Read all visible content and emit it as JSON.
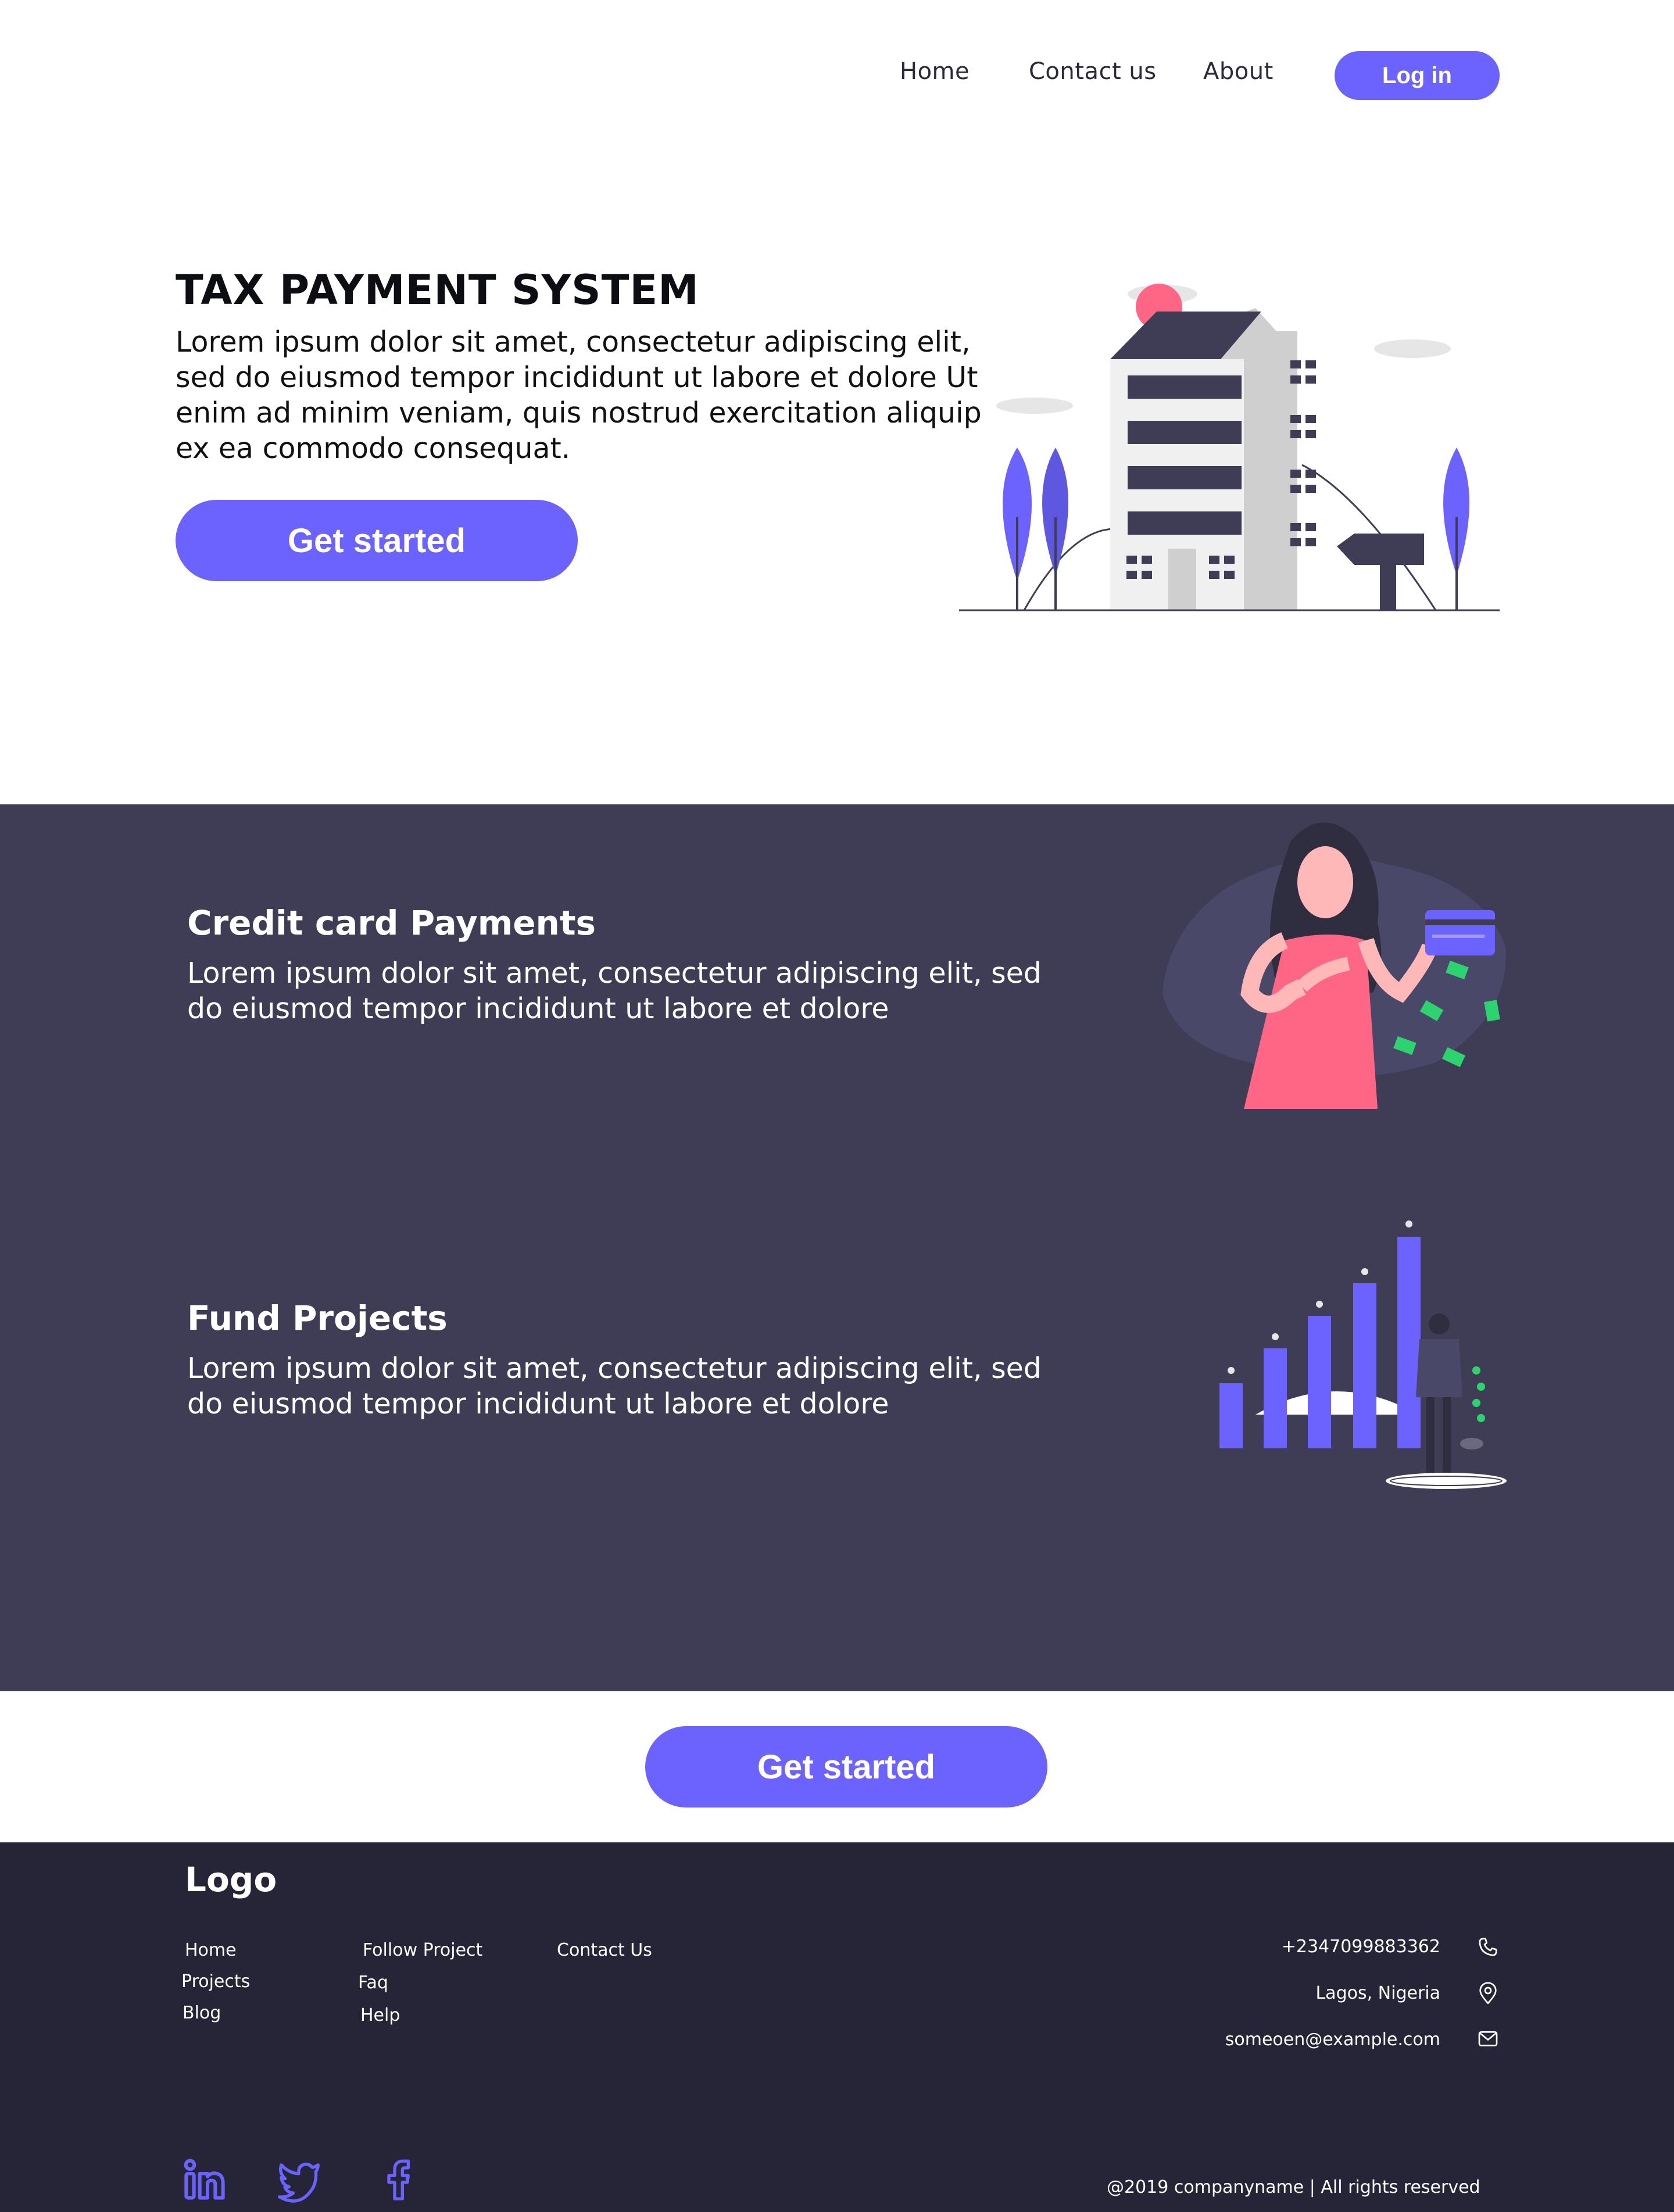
{
  "nav": {
    "home": "Home",
    "contact": "Contact us",
    "about": "About",
    "login": "Log in"
  },
  "hero": {
    "title": "TAX PAYMENT SYSTEM",
    "text": "Lorem ipsum dolor sit amet, consectetur adipiscing elit, sed do eiusmod tempor incididunt ut labore et dolore Ut enim ad minim veniam, quis nostrud exercitation aliquip ex ea commodo consequat.",
    "cta": "Get started"
  },
  "features": [
    {
      "title": "Credit card Payments",
      "text": "Lorem ipsum dolor sit amet, consectetur adipiscing elit, sed do eiusmod tempor incididunt ut labore et dolore"
    },
    {
      "title": "Fund Projects",
      "text": "Lorem ipsum dolor sit amet, consectetur adipiscing elit, sed do eiusmod tempor incididunt ut labore et dolore"
    }
  ],
  "bottom_cta": "Get started",
  "footer": {
    "logo": "Logo",
    "links_col1": [
      "Home",
      "Projects",
      "Blog"
    ],
    "links_col2": [
      "Follow Project",
      "Faq",
      "Help"
    ],
    "links_col3": [
      "Contact Us"
    ],
    "phone": "+2347099883362",
    "location": "Lagos, Nigeria",
    "email": "someoen@example.com",
    "copyright": "@2019 companyname | All rights reserved",
    "icons": [
      "phone-icon",
      "location-icon",
      "mail-icon",
      "linkedin-icon",
      "twitter-icon",
      "facebook-icon"
    ]
  },
  "colors": {
    "accent": "#6c63ff",
    "features_bg": "#3f3d56",
    "footer_bg": "#262537"
  }
}
